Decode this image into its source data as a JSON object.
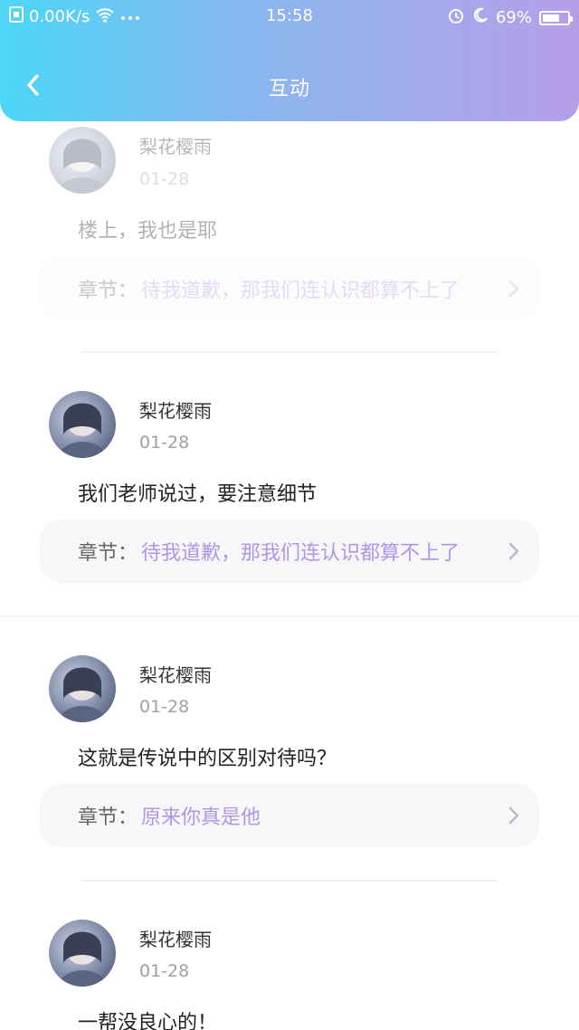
{
  "status": {
    "network_speed": "0.00K/s",
    "time": "15:58",
    "battery": "69%",
    "battery_level": 0.69,
    "icons": [
      "sim-icon",
      "wifi-icon",
      "more-dots-icon",
      "alarm-icon",
      "moon-icon",
      "battery-icon"
    ]
  },
  "header": {
    "title": "互动",
    "back_icon": "chevron-left-icon"
  },
  "feed": {
    "items": [
      {
        "user": "梨花樱雨",
        "date": "01-28",
        "comment": "楼上，我也是耶",
        "chapter_label": "章节：",
        "chapter_title": "待我道歉，那我们连认识都算不上了"
      },
      {
        "user": "梨花樱雨",
        "date": "01-28",
        "comment": "我们老师说过，要注意细节",
        "chapter_label": "章节：",
        "chapter_title": "待我道歉，那我们连认识都算不上了"
      },
      {
        "user": "梨花樱雨",
        "date": "01-28",
        "comment": "这就是传说中的区别对待吗？",
        "chapter_label": "章节：",
        "chapter_title": "原来你真是他"
      },
      {
        "user": "梨花樱雨",
        "date": "01-28",
        "comment": "一帮没良心的！"
      }
    ]
  },
  "colors": {
    "header_gradient_start": "#4cd6f7",
    "header_gradient_end": "#b79ee9",
    "chapter_accent": "#b195e7",
    "card_bg": "#f7f7f9"
  }
}
